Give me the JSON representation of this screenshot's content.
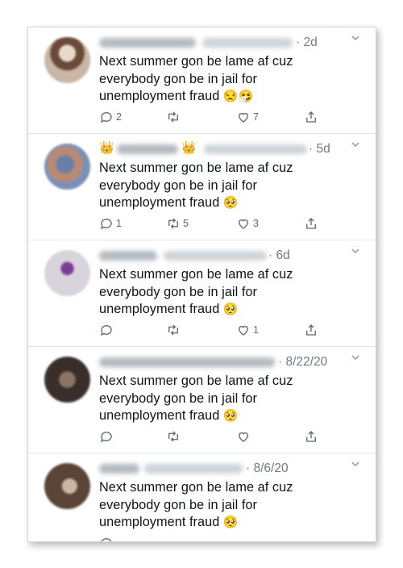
{
  "tweets": [
    {
      "time": "· 2d",
      "text": "Next summer gon be lame af cuz everybody gon be in jail for unemployment fraud",
      "emoji": "😒🤧",
      "reply_count": "2",
      "retweet_count": "",
      "like_count": "7"
    },
    {
      "time": "· 5d",
      "text": "Next summer gon be lame af cuz everybody gon be in jail for unemployment fraud",
      "emoji": "🥺",
      "reply_count": "1",
      "retweet_count": "5",
      "like_count": "3",
      "crowns": "👑"
    },
    {
      "time": "· 6d",
      "text": "Next summer gon be lame af cuz everybody gon be in jail for unemployment fraud",
      "emoji": "🥺",
      "reply_count": "",
      "retweet_count": "",
      "like_count": "1"
    },
    {
      "time": "· 8/22/20",
      "text": "Next summer gon be lame af cuz everybody gon be in jail for unemployment fraud",
      "emoji": "🥺",
      "reply_count": "",
      "retweet_count": "",
      "like_count": ""
    },
    {
      "time": "· 8/6/20",
      "text": "Next summer gon be lame af cuz everybody gon be in jail for unemployment fraud",
      "emoji": "🥺",
      "reply_count": "",
      "retweet_count": "",
      "like_count": ""
    }
  ],
  "icons": {
    "reply": "reply-icon",
    "retweet": "retweet-icon",
    "like": "like-icon",
    "share": "share-icon",
    "caret": "chevron-down-icon"
  },
  "colors": {
    "text": "#0f1419",
    "secondary": "#6e7a84",
    "border": "#dfe4e8"
  }
}
